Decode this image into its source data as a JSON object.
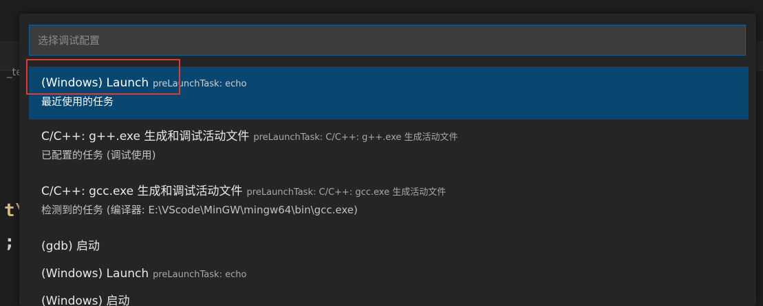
{
  "editor": {
    "tab_fragment": "_te",
    "code_line1": "t\\",
    "code_line2": ";"
  },
  "quick_pick": {
    "placeholder": "选择调试配置",
    "value": "",
    "items": [
      {
        "label": "(Windows) Launch",
        "description": "preLaunchTask: echo",
        "detail": "最近使用的任务"
      },
      {
        "label": "C/C++: g++.exe 生成和调试活动文件",
        "description": "preLaunchTask: C/C++: g++.exe 生成活动文件",
        "detail": "已配置的任务 (调试使用)"
      },
      {
        "label": "C/C++: gcc.exe 生成和调试活动文件",
        "description": "preLaunchTask: C/C++: gcc.exe 生成活动文件",
        "detail": "检测到的任务 (编译器: E:\\VScode\\MinGW\\mingw64\\bin\\gcc.exe)"
      },
      {
        "label": "(gdb) 启动",
        "description": "",
        "detail": ""
      },
      {
        "label": "(Windows) Launch",
        "description": "preLaunchTask: echo",
        "detail": ""
      },
      {
        "label": "(Windows) 启动",
        "description": "",
        "detail": ""
      }
    ]
  },
  "colors": {
    "annotation_box": "#e53935",
    "selection": "#094771",
    "focus_border": "#0e639c"
  }
}
